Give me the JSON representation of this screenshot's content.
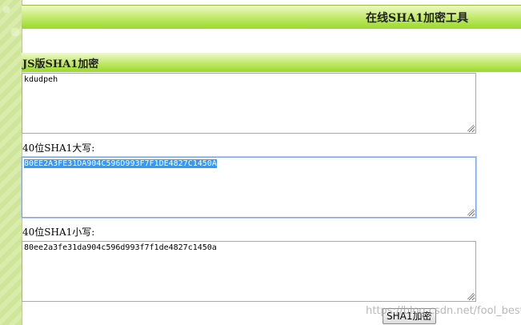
{
  "header": {
    "title": "在线SHA1加密工具"
  },
  "section": {
    "title": "JS版SHA1加密"
  },
  "input": {
    "value": "kdudpeh"
  },
  "upper": {
    "label": "40位SHA1大写:",
    "value": "80EE2A3FE31DA904C596D993F7F1DE4827C1450A"
  },
  "lower": {
    "label": "40位SHA1小写:",
    "value": "80ee2a3fe31da904c596d993f7f1de4827c1450a"
  },
  "button": {
    "label": "SHA1加密"
  },
  "watermark": {
    "text": "https://blog.csdn.net/fool_best"
  },
  "colors": {
    "header_green": "#9ad92a",
    "selection": "#3399ff"
  }
}
